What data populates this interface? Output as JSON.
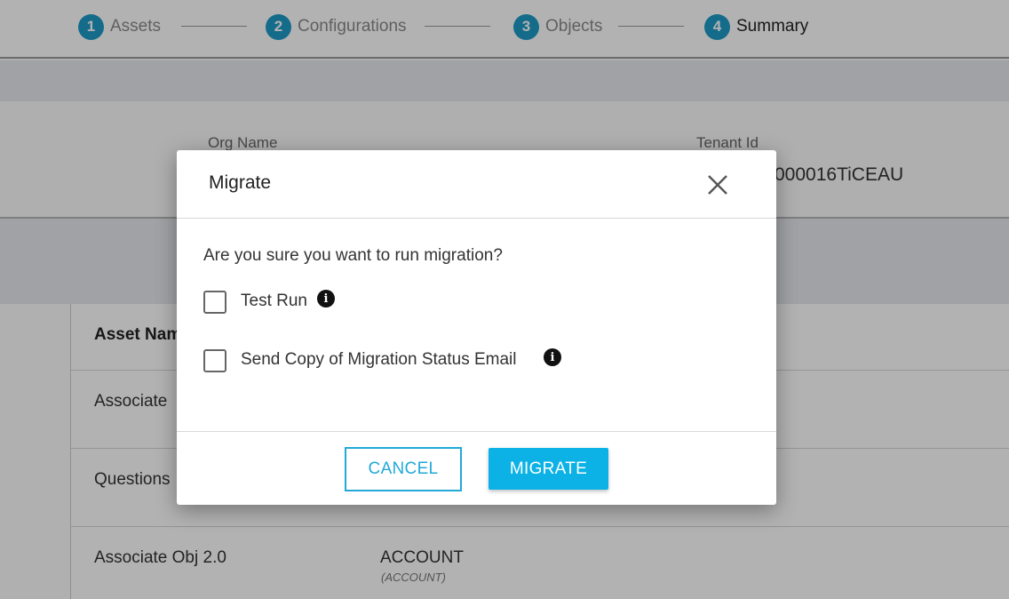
{
  "stepper": {
    "steps": [
      {
        "number": "1",
        "label": "Assets"
      },
      {
        "number": "2",
        "label": "Configurations"
      },
      {
        "number": "3",
        "label": "Objects"
      },
      {
        "number": "4",
        "label": "Summary"
      }
    ],
    "active_step": 4
  },
  "org": {
    "org_name_label": "Org Name",
    "tenant_id_label": "Tenant Id",
    "tenant_id_value_visible": "000016TiCEAU"
  },
  "table": {
    "header": "Asset Nam",
    "rows": [
      {
        "asset_name": "Associate"
      },
      {
        "asset_name": "Questions"
      },
      {
        "asset_name": "Associate Obj 2.0",
        "object": "ACCOUNT",
        "object_sub": "(ACCOUNT)"
      }
    ]
  },
  "modal": {
    "title": "Migrate",
    "question": "Are you sure you want to run migration?",
    "options": [
      {
        "label": "Test Run",
        "checked": false
      },
      {
        "label": "Send Copy of Migration Status Email",
        "checked": false
      }
    ],
    "cancel_label": "CANCEL",
    "migrate_label": "MIGRATE"
  },
  "colors": {
    "accent": "#1e9bc6",
    "primary_button": "#0cb2e6",
    "overlay": "rgba(0,0,0,0.3)"
  }
}
